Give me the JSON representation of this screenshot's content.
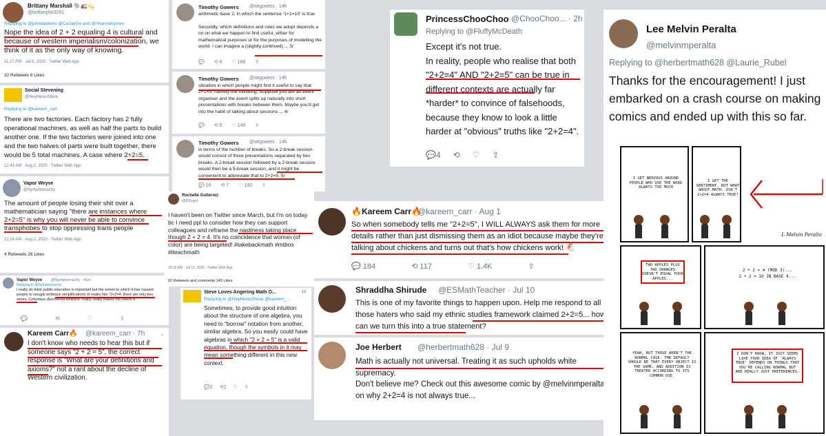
{
  "colors": {
    "link": "#1b95e0",
    "underline": "#d40b0b",
    "text": "#14171a",
    "muted": "#657786"
  },
  "t1": {
    "name": "Brittany Marshall 🐘🚛💫",
    "handle": "@brittanylm3281",
    "reply": "Replying to @johndawkins @CeJayGe and @nhannahjones",
    "text": "Nope the idea of 2 + 2 equaling 4 is cultural and because of western imperialism/colonization, we think of it as the only way of knowing.",
    "meta": "11:27 PM · Jul 5, 2020 · Twitter Web App",
    "stats": "32 Retweets   6 Likes"
  },
  "t2": {
    "name": "Social Stevening",
    "handle": "@HeyHeresSteve",
    "reply": "Replying to @kareem_carr",
    "text": "There are two factories. Each factory has 2 fully operational machines, as well as half the parts to build another one. If the two factories were joined into one and the two halves of parts were built together, there would be 5 total machines. A case where 2+2=5.",
    "meta": "12:43 AM · Aug 2, 2020 · Twitter Web App"
  },
  "t3": {
    "name": "Vapor Weyve",
    "handle": "@Nymphomachy",
    "text": "The amount of people losing their shit over a mathematician saying \"there are instances where 2+2=5\" is why you will never be able to convince transphobes to stop oppressing trans people",
    "meta": "12:24 AM · Aug 2, 2020 · Twitter Web App",
    "stats": "4 Retweets   26 Likes"
  },
  "t4": {
    "name": "Vapor Weyve",
    "handle": "@Nymphomachy · 41m",
    "reply": "Replying to @Nymphomachy",
    "text": "I really do think public education is important but the extent to which it has caused people to smugly embrace simplifications of reality like \"2+2=4, there are only two sexes, Columbus discovered America\" really, really makes me resent it"
  },
  "t5": {
    "name": "Kareem Carr🔥",
    "handle": "@kareem_carr · 7h",
    "text": "I don't know who needs to hear this but if someone says \"2 + 2 = 5\", the correct response is \"What are your definitions and axioms?\" not a rant about the decline of Western civilization."
  },
  "t6": {
    "name": "Timothy Gowers",
    "handle": "@wtgowers · 14h",
    "text": "arithmetic base 2, in which the sentence '1+1=10' is true.\n\nSecondly, which definitions and rules we adopt depends a lot on what we happen to find useful, either for mathematical purposes or for the purposes of modelling the world. I can imagine a (slightly contrived) ... 3/",
    "stats": [
      "6",
      "188"
    ]
  },
  "t7": {
    "name": "Timothy Gowers",
    "handle": "@wtgowers · 14h",
    "text": "situation in which people might find it useful to say that 2+2=5, namely the following. Suppose you are an event organiser and the event splits up naturally into short presentations with breaks between them. Maybe you'd get into the habit of talking about sessions ... 4/",
    "stats": [
      "5",
      "145"
    ]
  },
  "t8": {
    "name": "Timothy Gowers",
    "handle": "@wtgowers · 14h",
    "text": "in terms of the number of breaks. So a 2-break session would consist of three presentations separated by two breaks. A 2-break session followed by a 2-break session would then be a 5-break session, and it might be convenient to abbreviate that to 2+2=5.   5/",
    "stats": [
      "16",
      "7",
      "192"
    ]
  },
  "t9": {
    "name": "Rochelle Gutierrez",
    "handle": "@RGrgul",
    "text": "I haven't been on Twitter since March, but I'm on today bc I need ppl to consider how they can support colleagues and reframe the nastiness taking place though 2 + 2 = 4. It's no coincidence that womxn (of color) are being targeted! #takebackmath #mtbos #iteachmath",
    "meta": "10:32 AM · Jul 12, 2020 · Twitter Web App",
    "stats": "82 Retweets and comments    145 Likes"
  },
  "t10": {
    "name": "Steve Loves Angering Math O...",
    "handle": "· 1d",
    "reply": "Replying to @HeyHeresSteve @kareem_...",
    "text": "Sometimes, to provide good intuition about the structure of one algebra, you need to \"borrow\" notation from another, similar algebra. So you easily could have algebras in which \"2 + 2 = 5\" is a valid equation, though the symbols in it may mean something different in this new context.",
    "stats": [
      "2",
      "2"
    ]
  },
  "t11": {
    "name": "PrincessChooChoo",
    "handle": "@ChooChoo... · 2h",
    "reply": "Replying to @FluffyMcDeath",
    "text": "Except it's not true.\nIn reality, people who realise that both \"2+2=4\" AND \"2+2=5\" can be true in different contexts are actually far *harder* to convince of falsehoods, because they know to look a little harder at \"obvious\" truths like \"2+2=4\".",
    "stats": [
      "4"
    ]
  },
  "t12": {
    "name": "Lee Melvin Peralta",
    "handle": "@melvinmperalta",
    "reply": "Replying to @herbertmath628 @Laurie_Rubel",
    "text": "Thanks for the encouragement! I just embarked on a crash course on making comics and ended up with this so far."
  },
  "t13": {
    "name": "🔥Kareem Carr🔥",
    "handle": "@kareem_carr · Aug 1",
    "text": "So when somebody tells me \"2+2=5\", I WILL ALWAYS ask them for more details rather than just dismissing them as an idiot because maybe they're talking about chickens and turns out that's how chickens work! 🐔",
    "stats": [
      "184",
      "117",
      "1.4K"
    ]
  },
  "t14": {
    "name": "Shraddha Shirude",
    "handle": "@ESMathTeacher · Jul 10",
    "text": "This is one of my favorite things to happen upon. Help me respond to all those haters who said my ethnic studies framework claimed 2+2=5... how can we turn this into a true statement?"
  },
  "t15": {
    "name": "Joe Herbert",
    "handle": "@herbertmath628 · Jul 9",
    "text": "Math is actually not universal. Treating it as such upholds white supremacy.",
    "text2": "Don't believe me? Check out this awesome comic by @melvinmperalta on why 2+2=4 is not always true..."
  },
  "comic": {
    "p1": "I GET NERVOUS AROUND PEOPLE WHO USE THE WORD ALWAYS TOO MUCH",
    "p2": "I GET THE SENTIMENT. BUT WHAT ABOUT MATH. ISN'T 2+2=4 ALWAYS TRUE?",
    "p3": "TWO APPLES PLUS TWO ORANGES DOESN'T EQUAL FOUR APPLES...",
    "p4": "2 + 2 = 4 (MOD 3)...\n2 + 2 = 10 IN BASE 4...",
    "p5": "YEAH, BUT THOSE AREN'T THE NORMAL CASE. THE DEFAULT SHOULD BE THAT EVERY OBJECT IS THE SAME, AND ADDITION IS TREATED ACCORDING TO ITS COMMON USE.",
    "p6": "I DON'T KNOW, IT JUST SEEMS LIKE YOUR IDEA OF 'ALWAYS TRUE' DEPENDS ON THINGS THAT YOU'RE CALLING NORMAL BUT ARE REALLY JUST PREFERENCES.",
    "signature": "L Melvin Peralta"
  }
}
